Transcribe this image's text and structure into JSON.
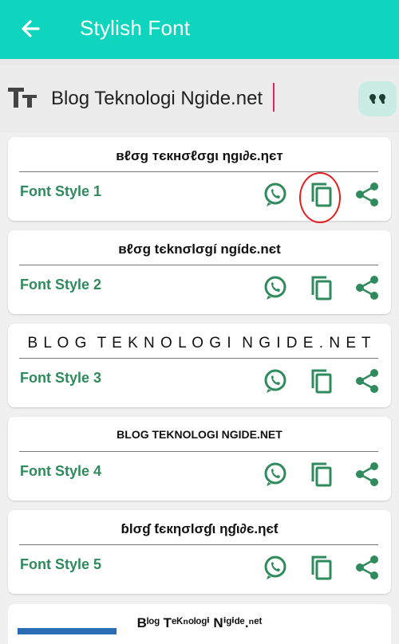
{
  "appbar": {
    "title": "Stylish Font"
  },
  "input": {
    "value": "Blog Teknologi Ngide.net"
  },
  "cards": [
    {
      "styled": "вℓσg тєкнσℓσgι ηgι∂є.ηєт",
      "label": "Font Style 1"
    },
    {
      "styled": "вℓσg tєknσlσgí ngídє.nєt",
      "label": "Font Style 2"
    },
    {
      "styled": "B L O G  T E K N O L O G I  N G I D E . N E T",
      "label": "Font Style 3"
    },
    {
      "styled": "BLOG TEKNOLOGI NGIDE.NET",
      "label": "Font Style 4"
    },
    {
      "styled": "ɓlσɠ ƭєкησlσɠι ηɠι∂є.ηєƭ",
      "label": "Font Style 5"
    },
    {
      "styled": "Bˡᵒᵍ Tᵉᴷⁿᵒˡᵒᵍⁱ Nⁱᵍⁱᵈᵉ.ⁿᵉᵗ"
    }
  ],
  "colors": {
    "accent": "#0fd4be",
    "label": "#2f8a5c",
    "highlight": "#e02020"
  }
}
